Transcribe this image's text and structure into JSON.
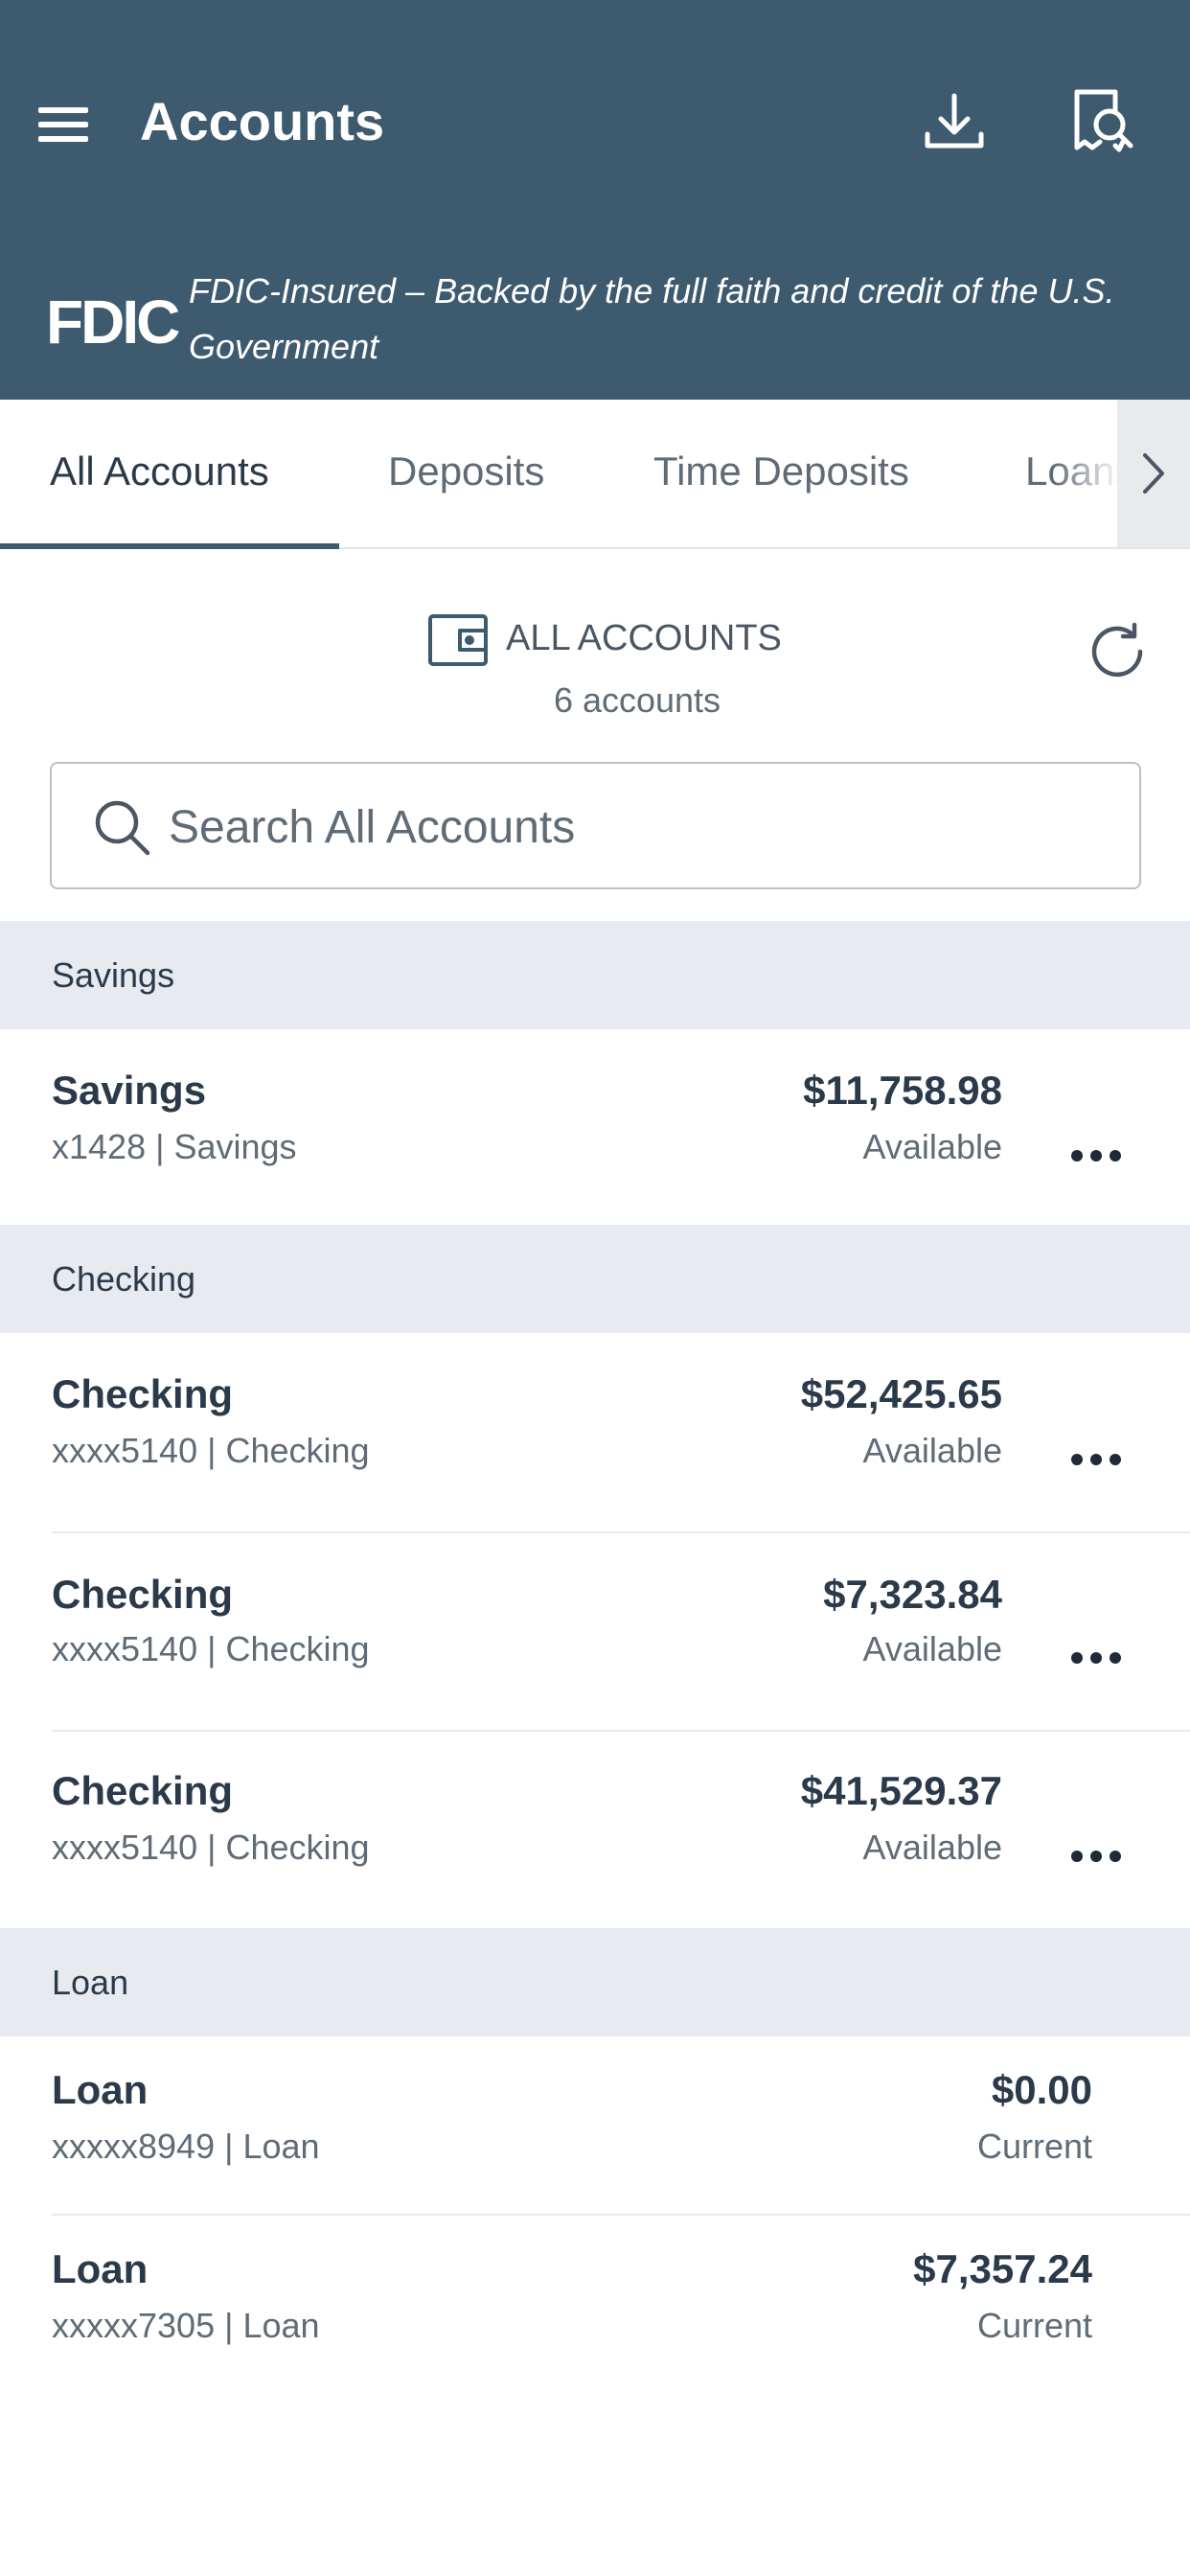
{
  "header": {
    "title": "Accounts",
    "fdic_logo": "FDIC",
    "fdic_text": "FDIC-Insured – Backed by the full faith and credit of the U.S. Government",
    "color": "#3d5a6e"
  },
  "tabs": [
    {
      "label": "All Accounts",
      "active": true
    },
    {
      "label": "Deposits",
      "active": false
    },
    {
      "label": "Time Deposits",
      "active": false
    },
    {
      "label": "Loans",
      "active": false
    }
  ],
  "summary": {
    "title": "ALL ACCOUNTS",
    "count": "6 accounts",
    "icon": "wallet-icon"
  },
  "search": {
    "placeholder": "Search All Accounts"
  },
  "sections": [
    {
      "title": "Savings",
      "accounts": [
        {
          "name": "Savings",
          "sub": "x1428 | Savings",
          "amount": "$11,758.98",
          "status": "Available"
        }
      ]
    },
    {
      "title": "Checking",
      "accounts": [
        {
          "name": "Checking",
          "sub": "xxxx5140 | Checking",
          "amount": "$52,425.65",
          "status": "Available"
        },
        {
          "name": "Checking",
          "sub": "xxxx5140 | Checking",
          "amount": "$7,323.84",
          "status": "Available"
        },
        {
          "name": "Checking",
          "sub": "xxxx5140 | Checking",
          "amount": "$41,529.37",
          "status": "Available"
        }
      ]
    },
    {
      "title": "Loan",
      "accounts": [
        {
          "name": "Loan",
          "sub": "xxxxx8949 | Loan",
          "amount": "$0.00",
          "status": "Current"
        },
        {
          "name": "Loan",
          "sub": "xxxxx7305 | Loan",
          "amount": "$7,357.24",
          "status": "Current"
        }
      ]
    }
  ]
}
